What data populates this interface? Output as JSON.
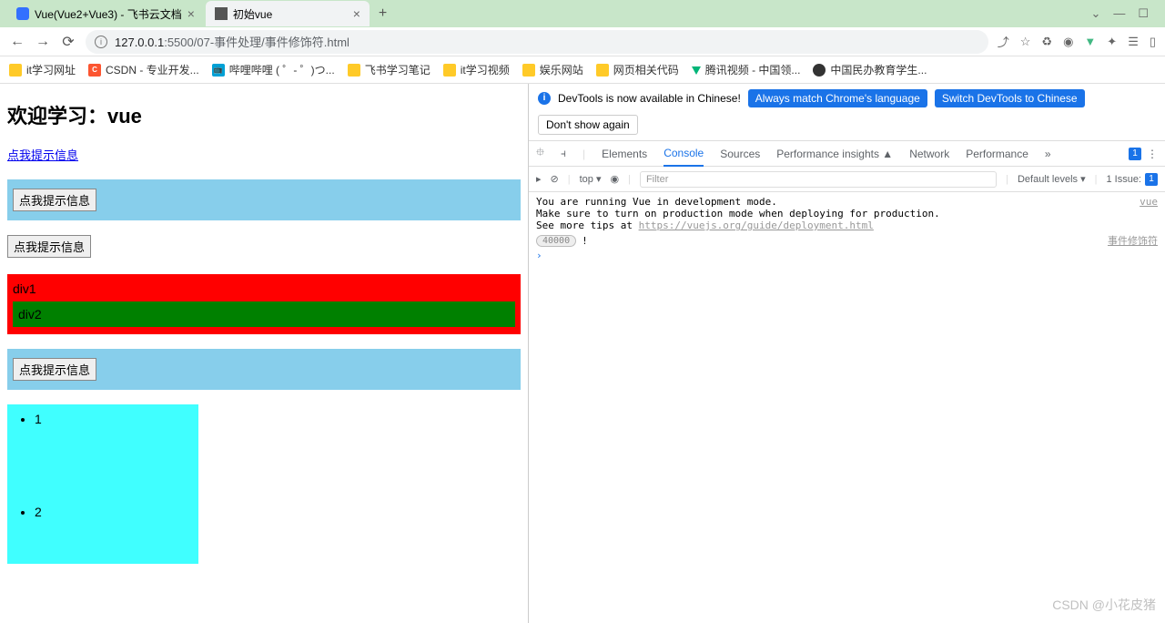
{
  "tabs": {
    "tab1": "Vue(Vue2+Vue3) - 飞书云文档",
    "tab2": "初始vue"
  },
  "url": {
    "host": "127.0.0.1",
    "path": ":5500/07-事件处理/事件修饰符.html"
  },
  "bookmarks": {
    "b1": "it学习网址",
    "b2": "CSDN - 专业开发...",
    "b3": "哔哩哔哩 ( ゜- ゜)つ...",
    "b4": "飞书学习笔记",
    "b5": "it学习视频",
    "b6": "娱乐网站",
    "b7": "网页相关代码",
    "b8": "腾讯视频 - 中国领...",
    "b9": "中国民办教育学生..."
  },
  "page": {
    "heading": "欢迎学习：vue",
    "link": "点我提示信息",
    "button1": "点我提示信息",
    "button2": "点我提示信息",
    "div1": "div1",
    "div2": "div2",
    "button3": "点我提示信息",
    "list": {
      "item1": "1",
      "item2": "2"
    }
  },
  "devtools": {
    "banner": {
      "text": "DevTools is now available in Chinese!",
      "btn1": "Always match Chrome's language",
      "btn2": "Switch DevTools to Chinese",
      "btn3": "Don't show again"
    },
    "tabs": {
      "elements": "Elements",
      "console": "Console",
      "sources": "Sources",
      "perfInsights": "Performance insights",
      "network": "Network",
      "performance": "Performance",
      "msgCount": "1"
    },
    "toolbar": {
      "top": "top ▾",
      "filter": "Filter",
      "levels": "Default levels ▾",
      "issue": "1 Issue:",
      "issueCount": "1"
    },
    "console": {
      "line1": "You are running Vue in development mode.",
      "line2": "Make sure to turn on production mode when deploying for production.",
      "line3": "See more tips at ",
      "link": "https://vuejs.org/guide/deployment.html",
      "src1": "vue",
      "badgeCount": "40000",
      "warnMsg": "!",
      "src2": "事件修饰符"
    }
  },
  "watermark": "CSDN @小花皮猪"
}
